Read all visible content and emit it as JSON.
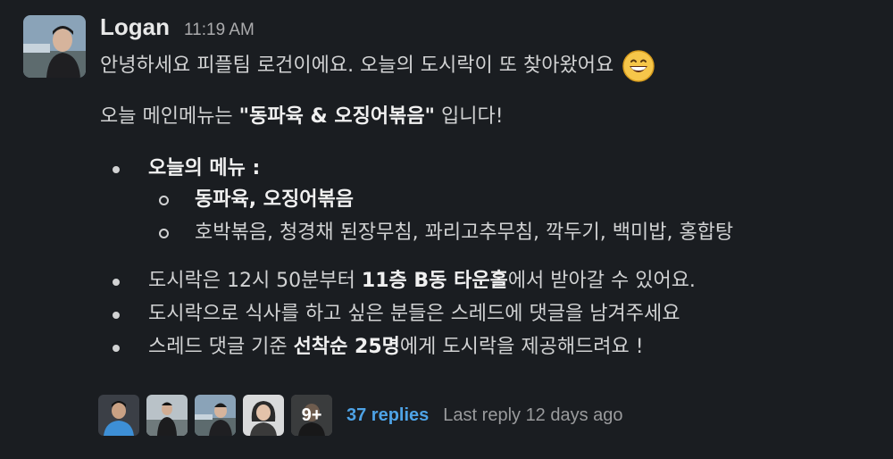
{
  "author": {
    "name": "Logan",
    "time": "11:19 AM"
  },
  "message": {
    "line1": "안녕하세요 피플팀 로건이에요. 오늘의 도시락이 또 찾아왔어요",
    "line1_emoji": "grinning-face-emoji",
    "line2_pre": "오늘 메인메뉴는 ",
    "line2_bold": "\"동파육 & 오징어볶음\"",
    "line2_post": " 입니다!",
    "menu_heading": "오늘의 메뉴 :",
    "menu_items": [
      {
        "text": "동파육, 오징어볶음",
        "bold": true
      },
      {
        "text": "호박볶음, 청경채 된장무침, 꽈리고추무침, 깍두기, 백미밥, 홍합탕",
        "bold": false
      }
    ],
    "bullet1_pre": "도시락은 12시 50분부터 ",
    "bullet1_bold": "11층 B동 타운홀",
    "bullet1_post": "에서 받아갈 수 있어요.",
    "bullet2": "도시락으로 식사를 하고 싶은 분들은 스레드에 댓글을 남겨주세요",
    "bullet3_pre": "스레드 댓글 기준 ",
    "bullet3_bold": "선착순 25명",
    "bullet3_post": "에게 도시락을 제공해드려요 !"
  },
  "thread": {
    "more_count": "9+",
    "replies": "37 replies",
    "last_reply": "Last reply 12 days ago"
  },
  "colors": {
    "background": "#1a1d21",
    "text": "#d1d2d3",
    "link": "#4ea3e6",
    "muted": "#9a9b9d"
  }
}
